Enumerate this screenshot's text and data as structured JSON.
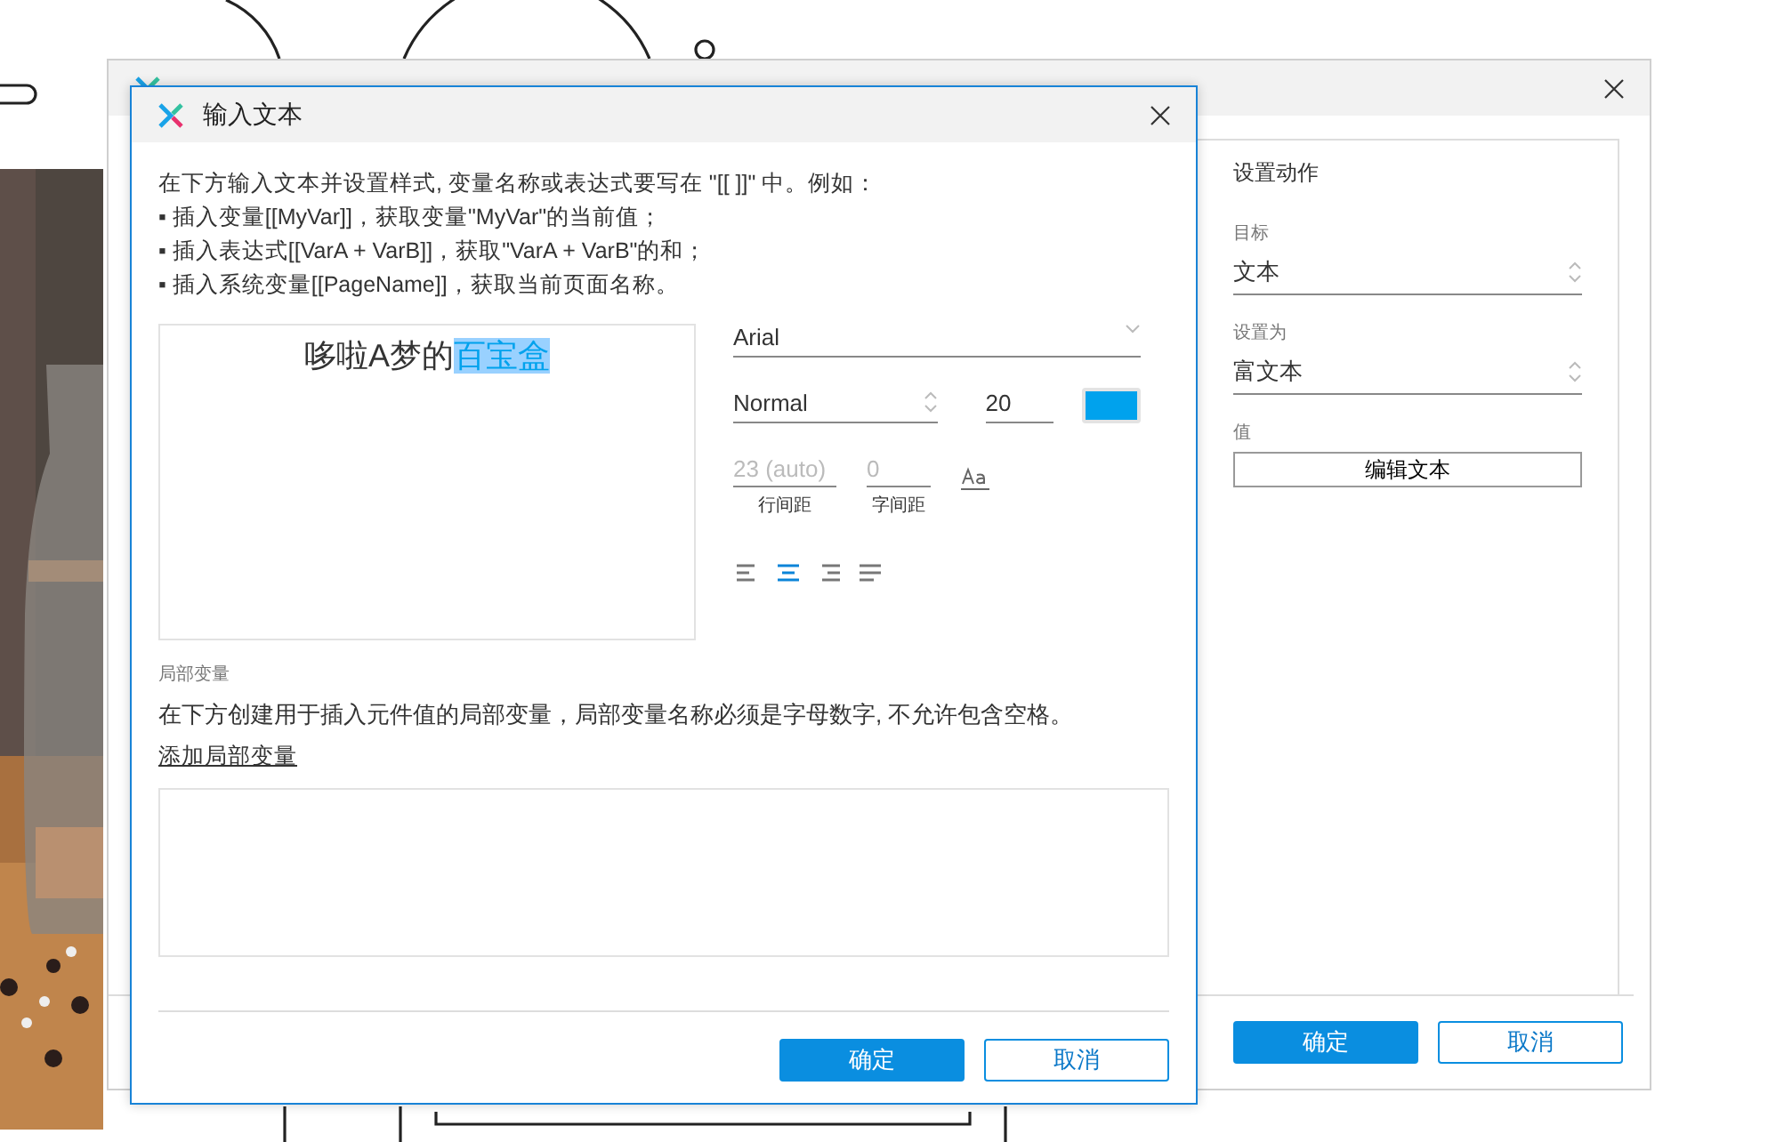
{
  "background_window": {
    "panel": {
      "heading": "设置动作",
      "fields": [
        {
          "kind": "select",
          "label": "目标",
          "value": "文本"
        },
        {
          "kind": "select",
          "label": "设置为",
          "value": "富文本"
        },
        {
          "kind": "button",
          "label": "值",
          "value": "编辑文本"
        }
      ]
    },
    "buttons": [
      {
        "kind": "primary",
        "label": "确定"
      },
      {
        "kind": "secondary",
        "label": "取消"
      }
    ]
  },
  "dialog": {
    "title": "输入文本",
    "instructions": [
      "在下方输入文本并设置样式, 变量名称或表达式要写在 \"[[ ]]\" 中。例如：",
      "▪ 插入变量[[MyVar]]，获取变量\"MyVar\"的当前值；",
      "▪ 插入表达式[[VarA + VarB]]，获取\"VarA + VarB\"的和；",
      "▪ 插入系统变量[[PageName]]，获取当前页面名称。"
    ],
    "editor": {
      "segments": [
        {
          "text": "哆啦A梦的",
          "selected": false
        },
        {
          "text": "百宝盒",
          "selected": true
        }
      ]
    },
    "font": {
      "family": "Arial",
      "style": "Normal",
      "size": "20",
      "color": "#00a2ed"
    },
    "spacing": [
      {
        "placeholder": "23 (auto)",
        "label": "行间距"
      },
      {
        "placeholder": "0",
        "label": "字间距"
      }
    ],
    "align": [
      {
        "kind": "left",
        "selected": false
      },
      {
        "kind": "center",
        "selected": true
      },
      {
        "kind": "right",
        "selected": false
      },
      {
        "kind": "justify",
        "selected": false
      }
    ],
    "local_vars": {
      "heading": "局部变量",
      "description": "在下方创建用于插入元件值的局部变量，局部变量名称必须是字母数字, 不允许包含空格。",
      "add_link": "添加局部变量"
    },
    "buttons": [
      {
        "kind": "primary",
        "label": "确定"
      },
      {
        "kind": "secondary",
        "label": "取消"
      }
    ]
  }
}
